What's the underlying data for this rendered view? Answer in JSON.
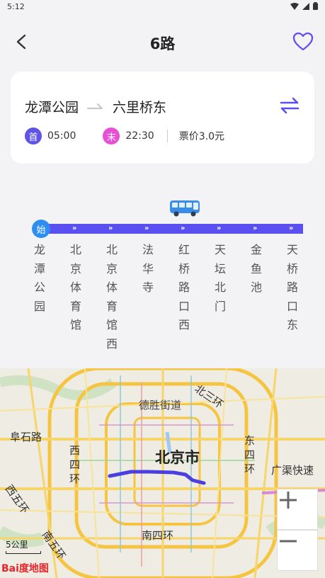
{
  "status": {
    "time": "5:12"
  },
  "header": {
    "title": "6路"
  },
  "route": {
    "from": "龙潭公园",
    "to": "六里桥东",
    "first_badge": "首",
    "first_time": "05:00",
    "last_badge": "末",
    "last_time": "22:30",
    "price": "票价3.0元"
  },
  "line": {
    "start_badge": "始",
    "stations": [
      "龙潭公园",
      "北京体育馆",
      "北京体育馆西",
      "法华寺",
      "红桥路口西",
      "天坛北门",
      "金鱼池",
      "天桥路口东"
    ]
  },
  "map": {
    "labels": {
      "deshengjie": "德胜街道",
      "beisanhuan": "北三环",
      "fuchenglu": "阜石路",
      "xisihuan": "西四环",
      "beijingshi": "北京市",
      "dongsihuan": "东四环",
      "guangqu": "广渠快速",
      "xiwuhuan": "西五环",
      "nanwuhuan": "南五环",
      "nansihuan": "南四环"
    },
    "scale": "5公里",
    "logo": "Bai度地图"
  }
}
